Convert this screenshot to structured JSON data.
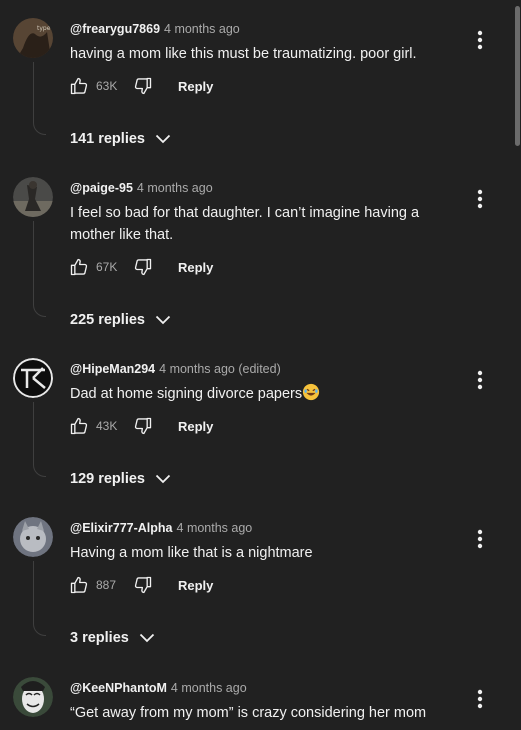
{
  "comments": [
    {
      "author": "@frearygu7869",
      "time": "4 months ago",
      "text": "having a mom like this must be traumatizing. poor girl.",
      "likes": "63K",
      "reply_label": "Reply",
      "replies_label": "141 replies",
      "avatar_color": "#5b4a3a"
    },
    {
      "author": "@paige-95",
      "time": "4 months ago",
      "text": "I feel so bad for that daughter. I can’t imagine having a mother like that.",
      "likes": "67K",
      "reply_label": "Reply",
      "replies_label": "225 replies",
      "avatar_color": "#6a6a6a"
    },
    {
      "author": "@HipeMan294",
      "time": "4 months ago (edited)",
      "text": "Dad at home signing divorce papers",
      "likes": "43K",
      "reply_label": "Reply",
      "replies_label": "129 replies",
      "avatar_color": "#111111"
    },
    {
      "author": "@Elixir777-Alpha",
      "time": "4 months ago",
      "text": "Having a mom like that is a nightmare",
      "likes": "887",
      "reply_label": "Reply",
      "replies_label": "3 replies",
      "avatar_color": "#8a8e96"
    },
    {
      "author": "@KeeNPhantoM",
      "time": "4 months ago",
      "text": "“Get away from my mom” is crazy considering her mom",
      "avatar_color": "#c8c8c8"
    }
  ],
  "icons": {
    "like": "thumbs-up-icon",
    "dislike": "thumbs-down-icon",
    "more": "more-vertical-icon",
    "expand": "chevron-down-icon",
    "emoji": "rolling-laughing-emoji"
  }
}
